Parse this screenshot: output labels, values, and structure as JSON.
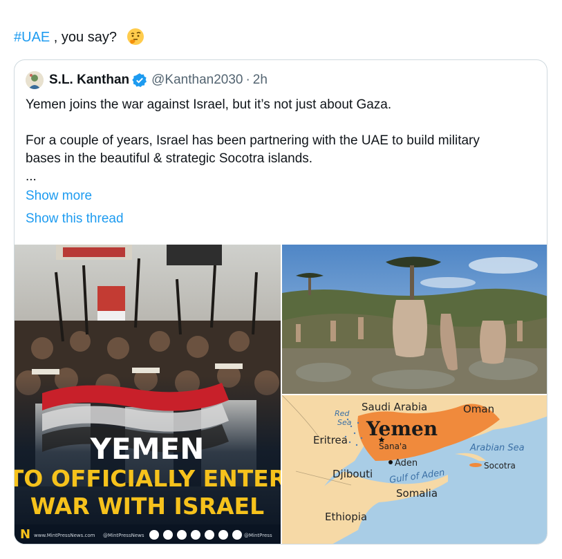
{
  "tweet": {
    "hashtag": "#UAE",
    "text_rest": " , you say?",
    "emoji": "thinking-face-emoji"
  },
  "quote": {
    "author_name": "S.L. Kanthan",
    "handle": "@Kanthan2030",
    "separator": "·",
    "time": "2h",
    "line1": "Yemen joins the war against Israel, but it’s not just about Gaza.",
    "line2": "For a couple of years, Israel has been partnering with the UAE to build military",
    "line3": "bases in the beautiful & strategic Socotra islands.",
    "ellipsis": "...",
    "show_more": "Show more",
    "show_thread": "Show this thread"
  },
  "media": {
    "poster": {
      "headline1": "YEMEN",
      "headline2": "TO OFFICIALLY ENTER",
      "headline3": "WAR WITH ISRAEL",
      "logo_letter": "N",
      "footer_site": "www.MintPressNews.com",
      "footer_handle": "@MintPressNews",
      "footer_handle2": "@MintPress"
    },
    "map": {
      "saudi": "Saudi Arabia",
      "oman": "Oman",
      "red_sea_1": "Red",
      "red_sea_2": "Sea",
      "yemen": "Yemen",
      "sanaa": "Sana'a",
      "eritrea": "Eritrea",
      "aden": "Aden",
      "gulf": "Gulf of Aden",
      "arabian_sea": "Arabian Sea",
      "socotra": "Socotra",
      "djibouti": "Djibouti",
      "somalia": "Somalia",
      "ethiopia": "Ethiopia"
    }
  },
  "colors": {
    "link": "#1d9bf0",
    "text": "#0f1419",
    "muted": "#536471",
    "border": "#cfd9de",
    "verified": "#1d9bf0",
    "yemen_fill": "#f08a3c",
    "poster_yellow": "#f6c21c"
  }
}
